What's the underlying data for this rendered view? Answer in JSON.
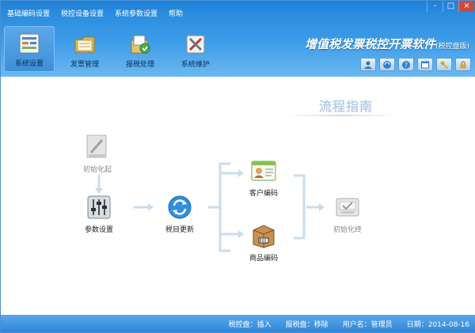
{
  "menu": [
    "基础编码设置",
    "税控设备设置",
    "系统参数设置",
    "帮助"
  ],
  "window_controls": [
    "-",
    "□",
    "×"
  ],
  "toolbar": [
    {
      "label": "系统设置",
      "icon": "settings-panel-icon",
      "active": true
    },
    {
      "label": "发票管理",
      "icon": "folder-icon",
      "active": false
    },
    {
      "label": "报税处理",
      "icon": "tax-report-icon",
      "active": false
    },
    {
      "label": "系统维护",
      "icon": "tools-icon",
      "active": false
    }
  ],
  "brand": {
    "title": "增值税发票税控开票软件",
    "subtitle": "(税控盘版)"
  },
  "quick_icons": [
    "user-icon",
    "refresh-globe-icon",
    "help-icon",
    "window-icon",
    "key-icon",
    "lock-icon"
  ],
  "guide": {
    "title": "流程指南"
  },
  "nodes": {
    "init_start": "初始化起",
    "params": "参数设置",
    "tax_update": "税目更新",
    "customer": "客户编码",
    "product": "商品编码",
    "init_end": "初始化终"
  },
  "status": {
    "disk": "税控盘：插入",
    "report_disk": "报税盘：移除",
    "user": "用户名：管理员",
    "date": "日期：2014-08-16"
  },
  "colors": {
    "header": "#2b8de0",
    "arrow": "#c8dced",
    "accent": "#1e7fd6"
  }
}
